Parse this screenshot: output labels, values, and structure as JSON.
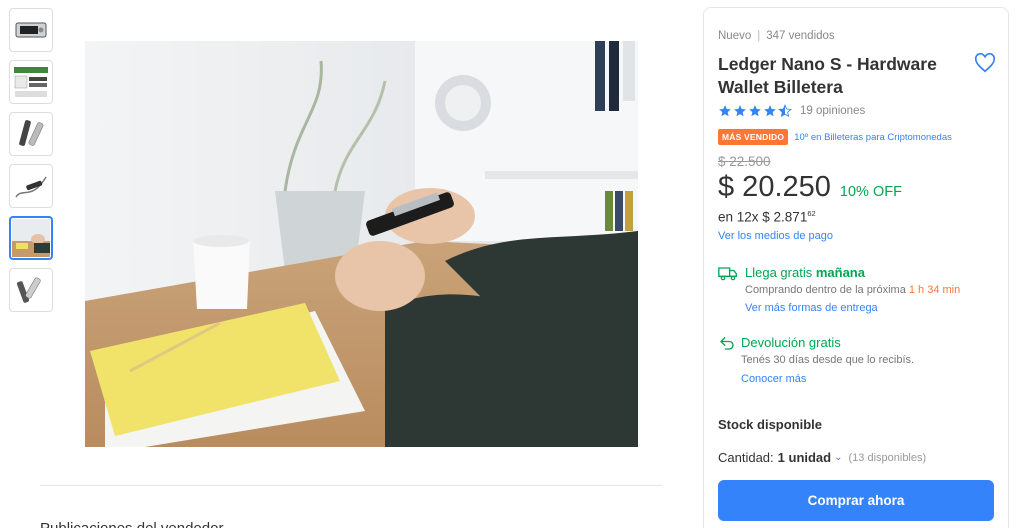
{
  "product": {
    "condition": "Nuevo",
    "sold": "347 vendidos",
    "title": "Ledger Nano S - Hardware Wallet Billetera",
    "rating": 4.5,
    "reviews": "19 opiniones",
    "badge": "MÁS VENDIDO",
    "ranking": "10º en Billeteras para Criptomonedas",
    "old_price": "$ 22.500",
    "price": "$ 20.250",
    "discount": "10% OFF",
    "installments_prefix": "en 12x $ 2.871",
    "installments_cents": "62",
    "payment_link": "Ver los medios de pago"
  },
  "shipping": {
    "title_prefix": "Llega gratis",
    "title_day": "mañana",
    "subtitle_prefix": "Comprando dentro de la próxima",
    "subtitle_time": "1 h 34 min",
    "link": "Ver más formas de entrega"
  },
  "returns": {
    "title": "Devolución gratis",
    "subtitle": "Tenés 30 días desde que lo recibís.",
    "link": "Conocer más"
  },
  "stock": {
    "label": "Stock disponible",
    "qty_label": "Cantidad:",
    "qty_value": "1 unidad",
    "available": "(13 disponibles)"
  },
  "actions": {
    "buy": "Comprar ahora"
  },
  "description": {
    "peek": "Publicaciones del vendedor"
  },
  "thumbnails": [
    {
      "icon": "usb-device-front",
      "active": false
    },
    {
      "icon": "package-contents",
      "active": false
    },
    {
      "icon": "device-pair",
      "active": false
    },
    {
      "icon": "device-with-cable",
      "active": false
    },
    {
      "icon": "device-in-hand",
      "active": true
    },
    {
      "icon": "device-open",
      "active": false
    }
  ],
  "colors": {
    "accent": "#3483fa",
    "success": "#00a650",
    "badge": "#ff7733"
  }
}
